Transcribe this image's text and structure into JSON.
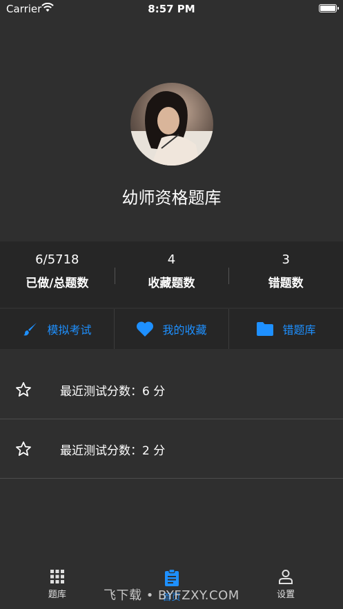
{
  "status_bar": {
    "carrier": "Carrier",
    "time": "8:57 PM"
  },
  "header": {
    "title": "幼师资格题库"
  },
  "stats": [
    {
      "value": "6/5718",
      "label": "已做/总题数"
    },
    {
      "value": "4",
      "label": "收藏题数"
    },
    {
      "value": "3",
      "label": "错题数"
    }
  ],
  "actions": [
    {
      "label": "模拟考试",
      "icon": "brush-icon"
    },
    {
      "label": "我的收藏",
      "icon": "heart-icon"
    },
    {
      "label": "错题库",
      "icon": "folder-icon"
    }
  ],
  "recent_scores": [
    {
      "text": "最近测试分数：6 分"
    },
    {
      "text": "最近测试分数：2 分"
    }
  ],
  "tab_bar": {
    "active": 1,
    "tabs": [
      {
        "label": "题库",
        "icon": "grid-icon"
      },
      {
        "label": "首页",
        "icon": "clipboard-icon"
      },
      {
        "label": "设置",
        "icon": "person-icon"
      }
    ]
  },
  "watermark": "飞下载 • BYFZXY.COM",
  "colors": {
    "accent": "#1e90ff",
    "background": "#2f2f2f",
    "panel": "#262626"
  }
}
